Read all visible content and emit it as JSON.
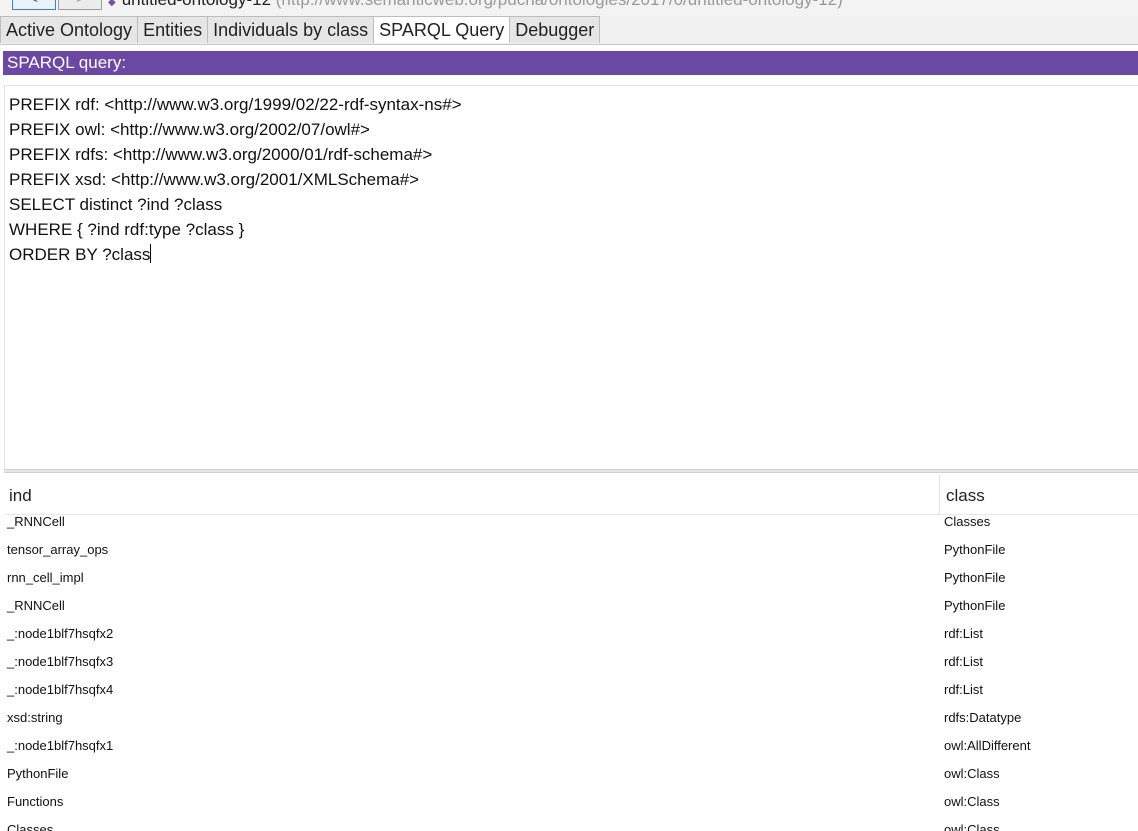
{
  "header": {
    "back_label": "<",
    "forward_label": ">",
    "ontology_name": "untitled-ontology-12",
    "ontology_iri": "(http://www.semanticweb.org/pucha/ontologies/2017/0/untitled-ontology-12)"
  },
  "tabs": [
    {
      "label": "Active Ontology"
    },
    {
      "label": "Entities"
    },
    {
      "label": "Individuals by class"
    },
    {
      "label": "SPARQL Query"
    },
    {
      "label": "Debugger"
    }
  ],
  "active_tab": "SPARQL Query",
  "panel": {
    "title": "SPARQL query:"
  },
  "query": {
    "lines": [
      "PREFIX rdf: <http://www.w3.org/1999/02/22-rdf-syntax-ns#>",
      "PREFIX owl: <http://www.w3.org/2002/07/owl#>",
      "PREFIX rdfs: <http://www.w3.org/2000/01/rdf-schema#>",
      "PREFIX xsd: <http://www.w3.org/2001/XMLSchema#>",
      "SELECT distinct ?ind ?class",
      "WHERE { ?ind rdf:type ?class }",
      "ORDER BY ?class"
    ]
  },
  "results": {
    "columns": [
      "ind",
      "class"
    ],
    "rows": [
      {
        "ind": "_RNNCell",
        "class": "Classes"
      },
      {
        "ind": "tensor_array_ops",
        "class": "PythonFile"
      },
      {
        "ind": "rnn_cell_impl",
        "class": "PythonFile"
      },
      {
        "ind": "_RNNCell",
        "class": "PythonFile"
      },
      {
        "ind": "_:node1blf7hsqfx2",
        "class": "rdf:List"
      },
      {
        "ind": "_:node1blf7hsqfx3",
        "class": "rdf:List"
      },
      {
        "ind": "_:node1blf7hsqfx4",
        "class": "rdf:List"
      },
      {
        "ind": "xsd:string",
        "class": "rdfs:Datatype"
      },
      {
        "ind": "_:node1blf7hsqfx1",
        "class": "owl:AllDifferent"
      },
      {
        "ind": "PythonFile",
        "class": "owl:Class"
      },
      {
        "ind": "Functions",
        "class": "owl:Class"
      },
      {
        "ind": "Classes",
        "class": "owl:Class"
      }
    ]
  },
  "colors": {
    "panel_header_bg": "#6b48a3",
    "panel_header_text": "#ffffff",
    "tab_active_bg": "#ffffff",
    "tab_bg": "#e6e6e6"
  }
}
